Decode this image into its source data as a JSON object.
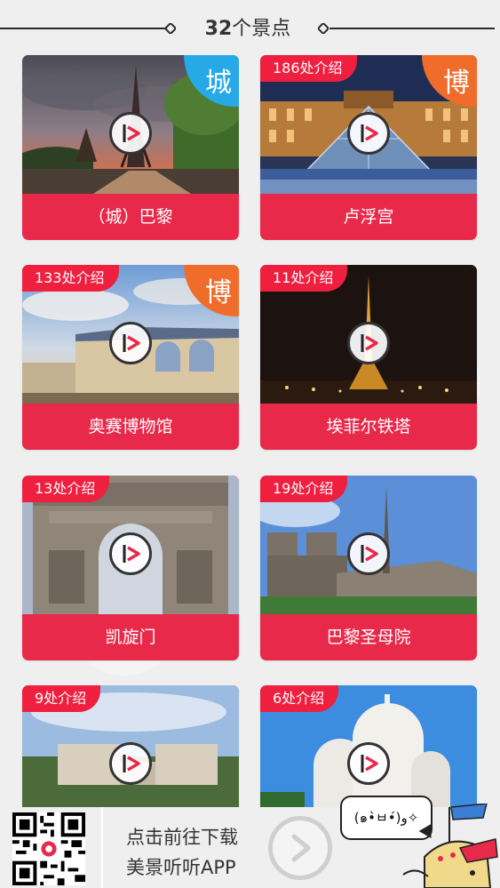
{
  "header": {
    "count": "32",
    "unit": "个景点"
  },
  "cards": [
    {
      "name": "（城）巴黎",
      "badge": "",
      "corner": "城"
    },
    {
      "name": "卢浮宫",
      "badge": "186处介绍",
      "corner": "博"
    },
    {
      "name": "奥赛博物馆",
      "badge": "133处介绍",
      "corner": "博"
    },
    {
      "name": "埃菲尔铁塔",
      "badge": "11处介绍",
      "corner": ""
    },
    {
      "name": "凯旋门",
      "badge": "13处介绍",
      "corner": ""
    },
    {
      "name": "巴黎圣母院",
      "badge": "19处介绍",
      "corner": ""
    },
    {
      "name": "",
      "badge": "9处介绍",
      "corner": ""
    },
    {
      "name": "",
      "badge": "6处介绍",
      "corner": ""
    }
  ],
  "banner": {
    "line1": "点击前往下载",
    "line2": "美景听听APP",
    "bubble": "(๑•̀ㅂ•́)و✧"
  },
  "colors": {
    "card_red": "#e8294a",
    "badge_red": "#ef1f3f",
    "corner_blue": "#27a9e8",
    "corner_orange": "#f06c2a"
  }
}
